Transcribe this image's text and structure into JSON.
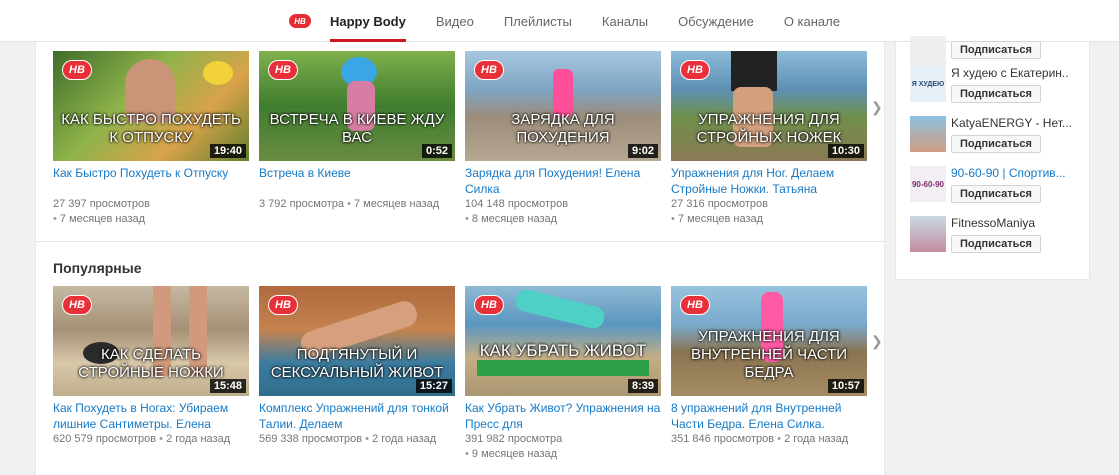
{
  "nav": {
    "logo_text": "HB",
    "tabs": [
      {
        "label": "Happy Body"
      },
      {
        "label": "Видео"
      },
      {
        "label": "Плейлисты"
      },
      {
        "label": "Каналы"
      },
      {
        "label": "Обсуждение"
      },
      {
        "label": "О канале"
      }
    ]
  },
  "shelf1": {
    "videos": [
      {
        "overlay": "Как быстро похудеть к отпуску",
        "duration": "19:40",
        "title": "Как Быстро Похудеть к Отпуску",
        "views": "27 397 просмотров",
        "age": "7 месяцев назад"
      },
      {
        "overlay": "Встреча в Киеве жду вас",
        "duration": "0:52",
        "title": "Встреча в Киеве",
        "views": "3 792 просмотра",
        "age": "7 месяцев назад"
      },
      {
        "overlay": "Зарядка для похудения",
        "duration": "9:02",
        "title": "Зарядка для Похудения! Елена Силка",
        "views": "104 148 просмотров",
        "age": "8 месяцев назад"
      },
      {
        "overlay": "Упражнения для стройных ножек",
        "duration": "10:30",
        "title": "Упражнения для Ног. Делаем Стройные Ножки. Татьяна",
        "views": "27 316 просмотров",
        "age": "7 месяцев назад"
      }
    ]
  },
  "shelf2": {
    "title": "Популярные",
    "videos": [
      {
        "overlay": "Как сделать стройные ножки",
        "duration": "15:48",
        "title": "Как Похудеть в Ногах: Убираем лишние Сантиметры. Елена",
        "views": "620 579 просмотров",
        "age": "2 года назад"
      },
      {
        "overlay": "Подтянутый и сексуальный живот",
        "duration": "15:27",
        "title": "Комплекс Упражнений для тонкой Талии. Делаем",
        "views": "569 338 просмотров",
        "age": "2 года назад"
      },
      {
        "overlay": "Как убрать живот",
        "duration": "8:39",
        "title": "Как Убрать Живот? Упражнения на Пресс для",
        "views": "391 982 просмотра",
        "age": "9 месяцев назад"
      },
      {
        "overlay": "Упражнения для внутренней части бедра",
        "duration": "10:57",
        "title": "8 упражнений для Внутренней Части Бедра. Елена Силка.",
        "views": "351 846 просмотров",
        "age": "2 года назад"
      }
    ]
  },
  "channels": {
    "subscribe_label": "Подписаться",
    "items": [
      {
        "name": "Я худею с Екатерин..",
        "avatar_text": "Я ХУДЕЮ"
      },
      {
        "name": "KatyaENERGY - Нет..."
      },
      {
        "name": "90-60-90 | Спортив...",
        "avatar_text": "90-60-90"
      },
      {
        "name": "FitnessoManiya"
      }
    ]
  }
}
